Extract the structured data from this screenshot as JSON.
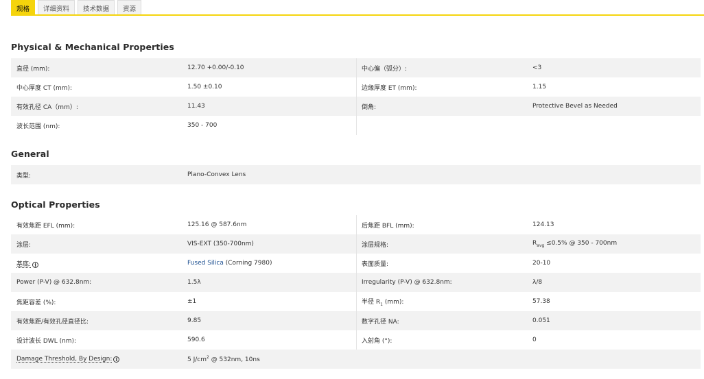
{
  "tabs": [
    {
      "label": "规格",
      "active": true
    },
    {
      "label": "详细资料",
      "active": false
    },
    {
      "label": "技术数据",
      "active": false
    },
    {
      "label": "资源",
      "active": false
    }
  ],
  "sections": {
    "physical": {
      "title": "Physical & Mechanical Properties",
      "rows": [
        {
          "l1": "直径 (mm):",
          "v1": "12.70 +0.00/-0.10",
          "l2": "中心偏（弧分）:",
          "v2": "<3"
        },
        {
          "l1": "中心厚度 CT (mm):",
          "v1": "1.50 ±0.10",
          "l2": "边缘厚度 ET (mm):",
          "v2": "1.15"
        },
        {
          "l1": "有效孔径 CA（mm）:",
          "v1": "11.43",
          "l2": "倒角:",
          "v2": "Protective Bevel as Needed"
        },
        {
          "l1": "波长范围 (nm):",
          "v1": "350 - 700",
          "l2": "",
          "v2": ""
        }
      ]
    },
    "general": {
      "title": "General",
      "rows": [
        {
          "l1": "类型:",
          "v1": "Plano-Convex Lens"
        }
      ]
    },
    "optical": {
      "title": "Optical Properties",
      "rows": [
        {
          "l1": "有效焦距 EFL (mm):",
          "v1": "125.16 @ 587.6nm",
          "l2": "后焦距 BFL (mm):",
          "v2": "124.13"
        },
        {
          "l1": "涂层:",
          "v1": "VIS-EXT (350-700nm)",
          "l2": "涂层规格:",
          "v2_pre": "R",
          "v2_sub": "avg",
          "v2_post": " ≤0.5% @ 350 - 700nm"
        },
        {
          "l1": "基底:",
          "v1_link": "Fused Silica",
          "v1_rest": " (Corning 7980)",
          "l2": "表面质量:",
          "v2": "20-10"
        },
        {
          "l1": "Power (P-V) @ 632.8nm:",
          "v1": "1.5λ",
          "l2": "Irregularity (P-V) @ 632.8nm:",
          "v2": "λ/8"
        },
        {
          "l1": "焦距容差 (%):",
          "v1": "±1",
          "l2_pre": "半径 R",
          "l2_sub": "1",
          "l2_post": " (mm):",
          "v2": "57.38"
        },
        {
          "l1": "有效焦距/有效孔径直径比:",
          "v1": "9.85",
          "l2": "数字孔径 NA:",
          "v2": "0.051"
        },
        {
          "l1": "设计波长 DWL (nm):",
          "v1": "590.6",
          "l2": "入射角 (°):",
          "v2": "0"
        },
        {
          "l1": "Damage Threshold, By Design:",
          "v1_pre": "5 J/cm",
          "v1_sup": "2",
          "v1_post": " @ 532nm, 10ns"
        }
      ]
    }
  },
  "icons": {
    "info": "info-circle-icon"
  },
  "colors": {
    "accent": "#f5d40c",
    "row_shade": "#f2f2f2",
    "link": "#1a4d8f"
  }
}
